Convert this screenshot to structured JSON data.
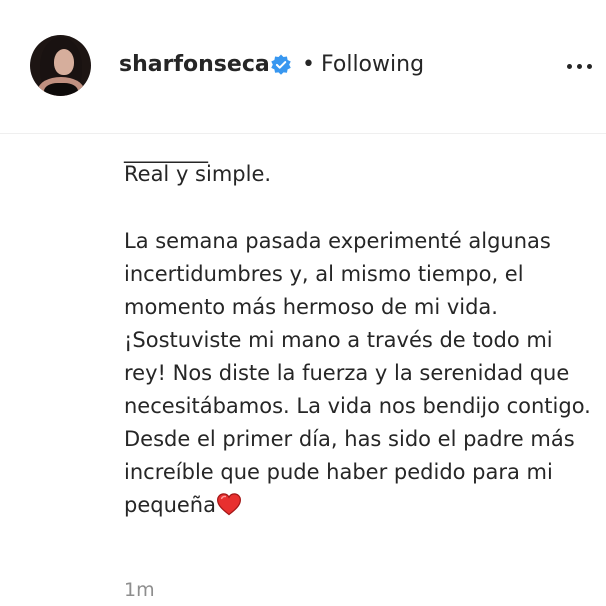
{
  "header": {
    "username": "sharfonseca",
    "separator": "•",
    "follow_status": "Following",
    "verified_icon": "verified-badge-icon",
    "more_icon": "more-options-icon",
    "verified_color": "#3897f0"
  },
  "caption": {
    "divider": "________",
    "line1": "Real y simple.",
    "body": "La semana pasada experimenté algunas incertidumbres y, al mismo tiempo, el momento más hermoso de mi vida. ¡Sostuviste mi mano a través de todo mi rey! Nos diste la fuerza y la serenidad que necesitábamos. La vida nos bendijo contigo. Desde el primer día, has sido el padre más increíble que pude haber pedido para mi pequeña",
    "emoji_icon": "red-heart-icon"
  },
  "meta": {
    "timestamp": "1m"
  }
}
